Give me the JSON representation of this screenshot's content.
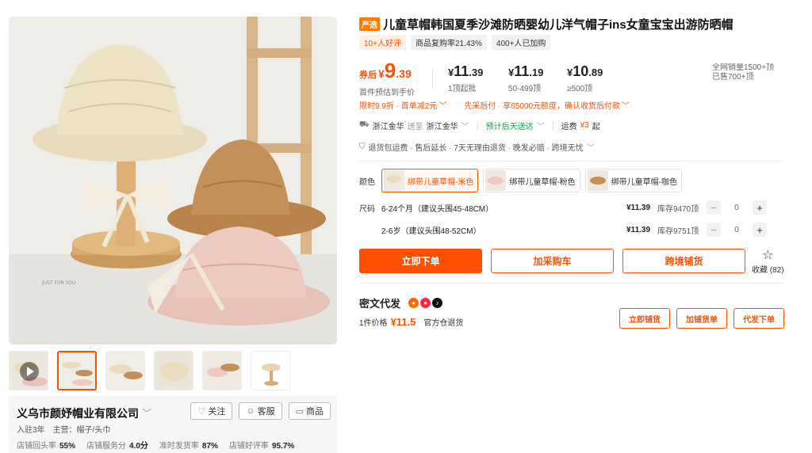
{
  "product": {
    "badge": "严选",
    "title": "儿童草帽韩国夏季沙滩防晒婴幼儿洋气帽子ins女童宝宝出游防晒帽",
    "tags": [
      "10+人好评",
      "商品复购率21.43%",
      "400+人已加购"
    ]
  },
  "price": {
    "coupon_label": "券后",
    "yen": "¥",
    "coupon_int": "9",
    "coupon_dec": ".39",
    "coupon_sub": "首件预估到手价",
    "tiers": [
      {
        "int": "11",
        "dec": ".39",
        "qty": "1顶起批"
      },
      {
        "int": "11",
        "dec": ".19",
        "qty": "50-499顶"
      },
      {
        "int": "10",
        "dec": ".89",
        "qty": "≥500顶"
      }
    ],
    "sales_cut": "全网销量1500+顶\n已售700+顶"
  },
  "promos": [
    "限时9.9折 · 首单减2元",
    "先采后付 · 享65000元额度，确认收货后付款"
  ],
  "shipping": {
    "from": "浙江金华",
    "to_word": "送至",
    "to": "浙江金华",
    "eta": "预计后天送达",
    "fee_label": "运费",
    "fee": "¥3",
    "fee_suffix": "起"
  },
  "guarantee": "退货包运费 · 售后延长 · 7天无理由退货 · 晚发必赔 · 跨境无忧",
  "sku": {
    "color_label": "颜色",
    "colors": [
      "绑带儿童草帽-米色",
      "绑带儿童草帽-粉色",
      "绑带儿童草帽-咖色"
    ],
    "size_label": "尺码",
    "sizes": [
      {
        "name": "6-24个月（建议头围45-48CM）",
        "price": "¥11.39",
        "stock": "库存9470顶",
        "qty": "0"
      },
      {
        "name": "2-6岁（建议头围48-52CM）",
        "price": "¥11.39",
        "stock": "库存9751顶",
        "qty": "0"
      }
    ]
  },
  "actions": {
    "buy": "立即下单",
    "cart": "加采购车",
    "cross": "跨境铺货",
    "fav": "收藏 (82)"
  },
  "dropship": {
    "title": "密文代发",
    "price_label": "1件价格",
    "price": "¥11.5",
    "warehouse": "官方仓退货",
    "buttons": [
      "立即铺货",
      "加铺货单",
      "代发下单"
    ]
  },
  "shop": {
    "name": "义乌市颜妤帽业有限公司",
    "follow": "关注",
    "service": "客服",
    "goods": "商品",
    "years": "入驻3年",
    "main": "主营：帽子/头巾",
    "stats": [
      {
        "label": "店铺回头率",
        "value": "55%"
      },
      {
        "label": "店铺服务分",
        "value": "4.0分"
      },
      {
        "label": "准时发货率",
        "value": "87%"
      },
      {
        "label": "店铺好评率",
        "value": "95.7%"
      }
    ]
  },
  "colors": {
    "accent": "#ff5000",
    "badge": "#ff7a00",
    "green": "#13a04c"
  }
}
